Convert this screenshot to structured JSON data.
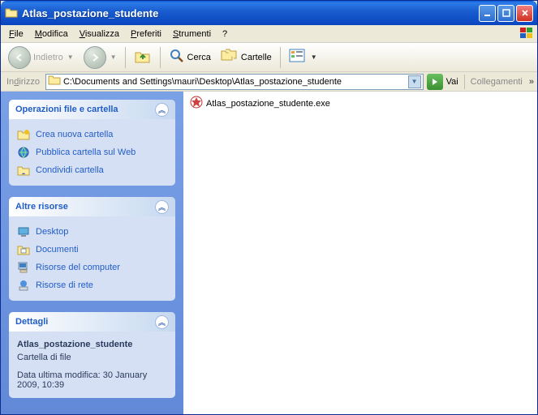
{
  "title": "Atlas_postazione_studente",
  "menu": {
    "file": "File",
    "modifica": "Modifica",
    "visualizza": "Visualizza",
    "preferiti": "Preferiti",
    "strumenti": "Strumenti",
    "help": "?"
  },
  "toolbar": {
    "back": "Indietro",
    "search": "Cerca",
    "folders": "Cartelle"
  },
  "address": {
    "label": "Indirizzo",
    "path": "C:\\Documents and Settings\\mauri\\Desktop\\Atlas_postazione_studente",
    "go": "Vai",
    "links": "Collegamenti"
  },
  "panels": {
    "tasks": {
      "title": "Operazioni file e cartella",
      "items": [
        "Crea nuova cartella",
        "Pubblica cartella sul Web",
        "Condividi cartella"
      ]
    },
    "places": {
      "title": "Altre risorse",
      "items": [
        "Desktop",
        "Documenti",
        "Risorse del computer",
        "Risorse di rete"
      ]
    },
    "details": {
      "title": "Dettagli",
      "name": "Atlas_postazione_studente",
      "type": "Cartella di file",
      "modified": "Data ultima modifica: 30 January 2009, 10:39"
    }
  },
  "files": [
    {
      "name": "Atlas_postazione_studente.exe"
    }
  ]
}
